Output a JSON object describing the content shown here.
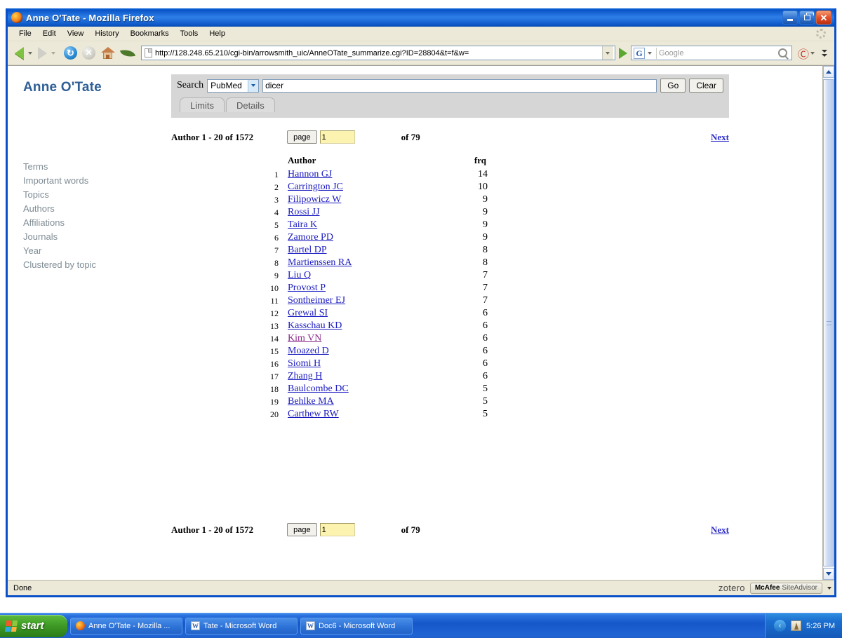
{
  "window": {
    "title": "Anne O'Tate - Mozilla Firefox",
    "minimize_label": "_",
    "restore_label": "❐",
    "close_label": "✕"
  },
  "menubar": {
    "items": [
      "File",
      "Edit",
      "View",
      "History",
      "Bookmarks",
      "Tools",
      "Help"
    ]
  },
  "navbar": {
    "url": "http://128.248.65.210/cgi-bin/arrowsmith_uic/AnneOTate_summarize.cgi?ID=28804&t=f&w=",
    "search_engine": "G",
    "search_placeholder": "Google",
    "adblock_label": "Ⓒ"
  },
  "page": {
    "brand": "Anne O'Tate",
    "sidebar": [
      "Terms",
      "Important words",
      "Topics",
      "Authors",
      "Affiliations",
      "Journals",
      "Year",
      "Clustered by topic"
    ],
    "search": {
      "label": "Search",
      "database": "PubMed",
      "query": "dicer",
      "go_label": "Go",
      "clear_label": "Clear",
      "tabs": [
        "Limits",
        "Details"
      ]
    },
    "pager": {
      "count_label": "Author 1 - 20 of 1572",
      "page_button": "page",
      "page_value": "1",
      "of_label": "of 79",
      "next_label": "Next"
    },
    "table": {
      "columns": [
        "Author",
        "frq"
      ],
      "rows": [
        {
          "index": "1",
          "author": "Hannon GJ",
          "frq": "14",
          "visited": false
        },
        {
          "index": "2",
          "author": "Carrington JC",
          "frq": "10",
          "visited": false
        },
        {
          "index": "3",
          "author": "Filipowicz W",
          "frq": "9",
          "visited": false
        },
        {
          "index": "4",
          "author": "Rossi JJ",
          "frq": "9",
          "visited": false
        },
        {
          "index": "5",
          "author": "Taira K",
          "frq": "9",
          "visited": false
        },
        {
          "index": "6",
          "author": "Zamore PD",
          "frq": "9",
          "visited": false
        },
        {
          "index": "7",
          "author": "Bartel DP",
          "frq": "8",
          "visited": false
        },
        {
          "index": "8",
          "author": "Martienssen RA",
          "frq": "8",
          "visited": false
        },
        {
          "index": "9",
          "author": "Liu Q",
          "frq": "7",
          "visited": false
        },
        {
          "index": "10",
          "author": "Provost P",
          "frq": "7",
          "visited": false
        },
        {
          "index": "11",
          "author": "Sontheimer EJ",
          "frq": "7",
          "visited": false
        },
        {
          "index": "12",
          "author": "Grewal SI",
          "frq": "6",
          "visited": false
        },
        {
          "index": "13",
          "author": "Kasschau KD",
          "frq": "6",
          "visited": false
        },
        {
          "index": "14",
          "author": "Kim VN",
          "frq": "6",
          "visited": true
        },
        {
          "index": "15",
          "author": "Moazed D",
          "frq": "6",
          "visited": false
        },
        {
          "index": "16",
          "author": "Siomi H",
          "frq": "6",
          "visited": false
        },
        {
          "index": "17",
          "author": "Zhang H",
          "frq": "6",
          "visited": false
        },
        {
          "index": "18",
          "author": "Baulcombe DC",
          "frq": "5",
          "visited": false
        },
        {
          "index": "19",
          "author": "Behlke MA",
          "frq": "5",
          "visited": false
        },
        {
          "index": "20",
          "author": "Carthew RW",
          "frq": "5",
          "visited": false
        }
      ]
    }
  },
  "statusbar": {
    "status": "Done",
    "zotero": "zotero",
    "mcafee_brand": "McAfee",
    "mcafee_product": "SiteAdvisor"
  },
  "taskbar": {
    "start_label": "start",
    "items": [
      {
        "label": "Anne O'Tate - Mozilla ...",
        "icon": "firefox-icon"
      },
      {
        "label": "Tate - Microsoft Word",
        "icon": "word-icon"
      },
      {
        "label": "Doc6 - Microsoft Word",
        "icon": "word-icon"
      }
    ],
    "clock": "5:26 PM"
  },
  "colors": {
    "title_blue": "#0a55c8",
    "brand_blue": "#2e5f96",
    "link_blue": "#1a1ac0",
    "link_visited": "#8b2c8b",
    "page_input_yellow": "#fdf3b0",
    "panel_gray": "#d6d6d6"
  }
}
